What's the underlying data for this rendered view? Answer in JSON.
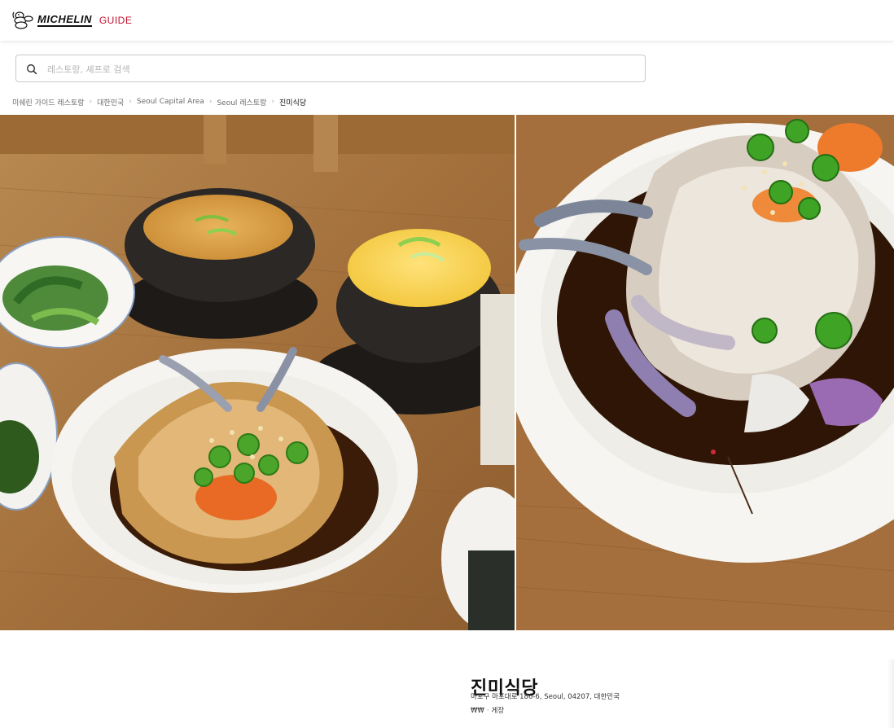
{
  "header": {
    "brand": "MICHELIN",
    "guide": "GUIDE"
  },
  "search": {
    "placeholder": "레스토랑, 셰프로 검색",
    "value": ""
  },
  "breadcrumb": {
    "items": [
      "미쉐린 가이드 레스토랑",
      "대한민국",
      "Seoul Capital Area",
      "Seoul 레스토랑",
      "진미식당"
    ],
    "separator": ">"
  },
  "restaurant": {
    "name": "진미식당",
    "address": "마포구 마포대로 186-6, Seoul, 04207, 대한민국",
    "price": "₩₩",
    "cuisine": "게장"
  },
  "colors": {
    "guide_red": "#c4122f",
    "table_wood": "#a8743f",
    "sauce": "#3a1c08"
  },
  "icons": {
    "logo": "michelin-man-icon",
    "search": "search-icon",
    "separator": "chevron-right-icon"
  }
}
